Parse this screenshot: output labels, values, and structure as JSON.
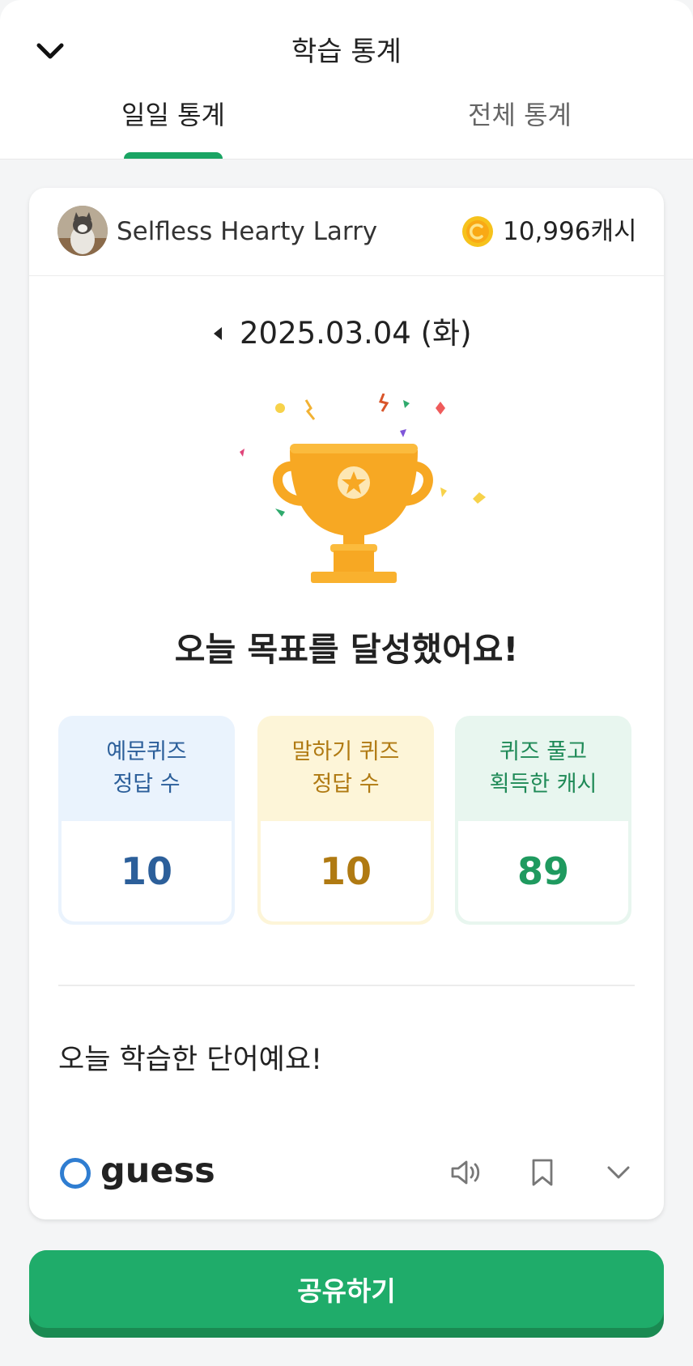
{
  "header": {
    "title": "학습 통계",
    "tabs": [
      {
        "label": "일일 통계",
        "active": true
      },
      {
        "label": "전체 통계",
        "active": false
      }
    ]
  },
  "profile": {
    "username": "Selfless Hearty Larry",
    "cash": "10,996캐시"
  },
  "date": "2025.03.04 (화)",
  "goal_message": "오늘 목표를 달성했어요!",
  "stats": [
    {
      "label_line1": "예문퀴즈",
      "label_line2": "정답 수",
      "value": "10",
      "color": "#2c5f9a"
    },
    {
      "label_line1": "말하기 퀴즈",
      "label_line2": "정답 수",
      "value": "10",
      "color": "#b07a12"
    },
    {
      "label_line1": "퀴즈 풀고",
      "label_line2": "획득한 캐시",
      "value": "89",
      "color": "#1f9a5f"
    }
  ],
  "words_section": {
    "title": "오늘 학습한 단어예요!",
    "items": [
      {
        "word": "guess"
      }
    ]
  },
  "share_button": "공유하기",
  "colors": {
    "accent": "#1fac6a",
    "tab_indicator": "#1aa463",
    "trophy": "#f7a823"
  }
}
